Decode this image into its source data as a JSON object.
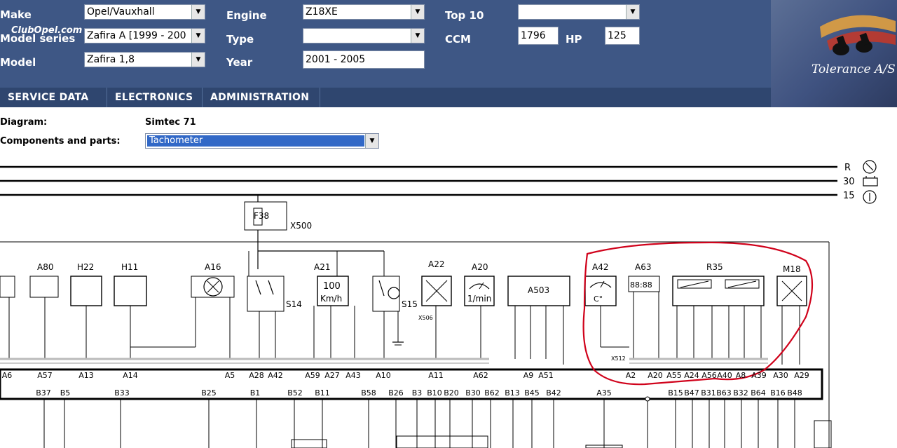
{
  "header": {
    "make_label": "Make",
    "model_series_label": "Model series",
    "model_label": "Model",
    "make_value": "Opel/Vauxhall",
    "model_series_value": "Zafira A [1999 - 200",
    "model_value": "Zafira 1,8",
    "engine_label": "Engine",
    "type_label": "Type",
    "year_label": "Year",
    "engine_value": "Z18XE",
    "type_value": "",
    "year_value": "2001 - 2005",
    "top10_label": "Top 10",
    "ccm_label": "CCM",
    "hp_label": "HP",
    "top10_value": "",
    "ccm_value": "1796",
    "hp_value": "125",
    "watermark": "ClubOpel.com"
  },
  "brand": {
    "name": "Tolerance A/S"
  },
  "nav": {
    "tabs": [
      "SERVICE DATA",
      "ELECTRONICS",
      "ADMINISTRATION"
    ]
  },
  "info": {
    "diagram_label": "Diagram:",
    "diagram_value": "Simtec 71",
    "components_label": "Components and parts:",
    "components_value": "Tachometer"
  },
  "diagram": {
    "rails": [
      "R",
      "30",
      "15"
    ],
    "fuse": "F38",
    "fuse_connector": "X500",
    "components": [
      "A80",
      "H22",
      "H11",
      "A16",
      "S14",
      "A21",
      "S15",
      "A22",
      "A20",
      "A503",
      "A42",
      "A63",
      "R35",
      "M18"
    ],
    "speedo_value": "100",
    "speedo_unit": "Km/h",
    "rev_unit": "1/min",
    "temp_unit": "C°",
    "clock_digits": "88:88",
    "connector_x512": "X512",
    "connector_x506": "X506",
    "upper_pins": [
      "A6",
      "A57",
      "A13",
      "A14",
      "A5",
      "A28",
      "A42",
      "A59",
      "A27",
      "A43",
      "A10",
      "A11",
      "A62",
      "A9",
      "A51",
      "A2",
      "A20",
      "A55",
      "A24",
      "A56",
      "A40",
      "A8",
      "A39",
      "A30",
      "A29"
    ],
    "lower_pins": [
      "B37",
      "B5",
      "B33",
      "B25",
      "B1",
      "B52",
      "B11",
      "B58",
      "B26",
      "B3",
      "B10",
      "B20",
      "B30",
      "B62",
      "B13",
      "B45",
      "B42",
      "A35",
      "B15",
      "B47",
      "B31",
      "B63",
      "B32",
      "B64",
      "B16",
      "B48"
    ]
  }
}
